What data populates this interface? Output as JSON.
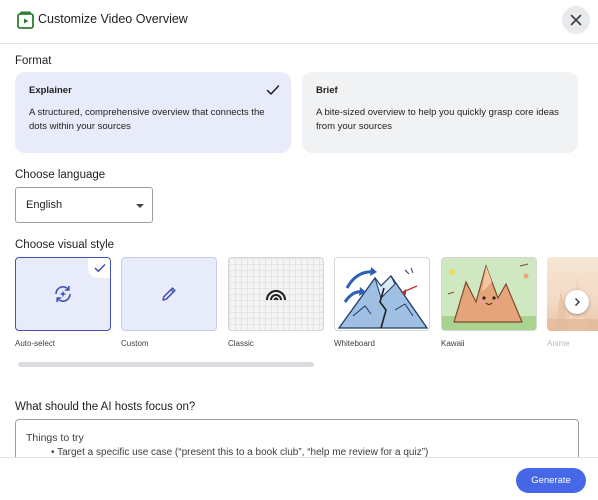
{
  "header": {
    "title": "Customize Video Overview",
    "app_icon": "video-overview-icon",
    "close_icon": "close-icon"
  },
  "format": {
    "label": "Format",
    "options": [
      {
        "title": "Explainer",
        "description": "A structured, comprehensive overview that connects the dots within your sources",
        "selected": true
      },
      {
        "title": "Brief",
        "description": "A bite-sized overview to help you quickly grasp core ideas from your sources",
        "selected": false
      }
    ]
  },
  "language": {
    "label": "Choose language",
    "value": "English"
  },
  "visual_style": {
    "label": "Choose visual style",
    "options": [
      {
        "label": "Auto-select",
        "icon": "auto-select-icon",
        "selected": true
      },
      {
        "label": "Custom",
        "icon": "pencil-icon",
        "selected": false
      },
      {
        "label": "Classic",
        "icon": "rainbow-icon",
        "selected": false
      },
      {
        "label": "Whiteboard",
        "icon": "whiteboard-illustration",
        "selected": false
      },
      {
        "label": "Kawaii",
        "icon": "kawaii-illustration",
        "selected": false
      },
      {
        "label": "Anime",
        "icon": "anime-illustration",
        "selected": false
      }
    ],
    "next_icon": "chevron-right-icon"
  },
  "focus": {
    "label": "What should the AI hosts focus on?",
    "placeholder_title": "Things to try",
    "placeholder_bullet": "• Target a specific use case (“present this to a book club”, “help me review for a quiz”)"
  },
  "footer": {
    "generate_label": "Generate"
  },
  "colors": {
    "accent": "#4668e6",
    "selected_bg": "#e8ebf9",
    "card_bg": "#f1f2f4",
    "selected_border": "#3f51b5"
  }
}
